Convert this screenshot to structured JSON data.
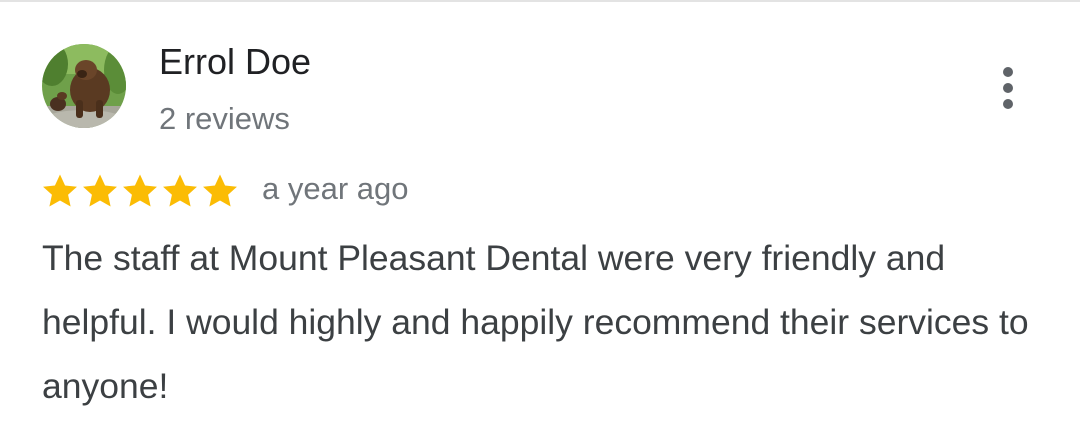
{
  "review": {
    "reviewer_name": "Errol Doe",
    "review_count": "2 reviews",
    "rating": 5,
    "rating_max": 5,
    "time": "a year ago",
    "text": "The staff at Mount Pleasant Dental were very friendly and helpful. I would highly and happily recommend their services to anyone!"
  },
  "icons": {
    "avatar": "bear-photo-avatar",
    "menu": "more-vert-icon",
    "star": "star-icon"
  },
  "colors": {
    "star": "#fbbc04",
    "name": "#202124",
    "secondary": "#70757a",
    "body_text": "#3c4043",
    "menu_icon": "#5f6368"
  }
}
